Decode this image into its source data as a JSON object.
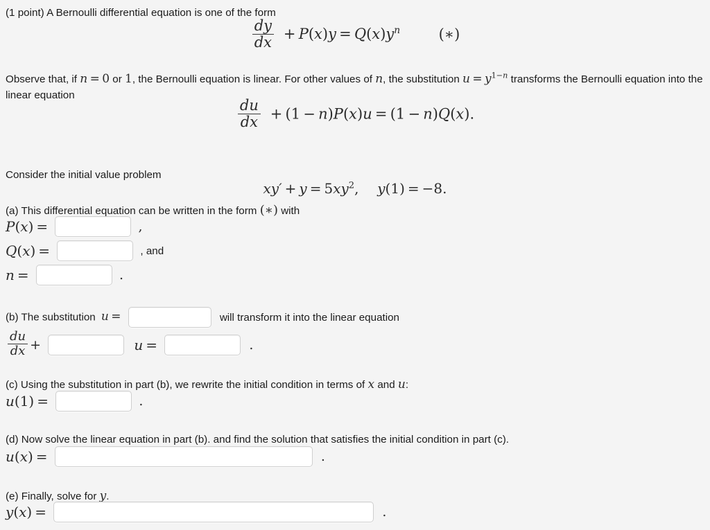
{
  "problem": {
    "points_label": "(1 point)",
    "intro_text": "A Bernoulli differential equation is one of the form",
    "star_tag": "(∗)",
    "observe_line1_a": "Observe that, if",
    "observe_n_eq_0": "n = 0",
    "observe_or": "or",
    "observe_one": "1",
    "observe_line1_b": ", the Bernoulli equation is linear. For other values of",
    "observe_n": "n",
    "observe_line1_c": ", the substitution",
    "observe_sub": "u = y^(1−n)",
    "observe_line1_d": "transforms the Bernoulli",
    "observe_line2": "equation into the linear equation",
    "consider_text": "Consider the initial value problem",
    "ivp": "xy′ + y = 5xy²,    y(1) = −8."
  },
  "equations": {
    "bernoulli": {
      "frac_numer": "dy",
      "frac_denom": "dx",
      "rest": "+ P(x)y = Q(x)yⁿ"
    },
    "linear": {
      "frac_numer": "du",
      "frac_denom": "dx",
      "rest": "+ (1 − n)P(x)u = (1 − n)Q(x)."
    }
  },
  "parts": {
    "a": {
      "prompt_pre": "(a) This differential equation can be written in the form",
      "prompt_star": "(∗)",
      "prompt_post": "with",
      "px_label": "P(x) =",
      "px_value": "",
      "px_trailing": ",",
      "qx_label": "Q(x) =",
      "qx_value": "",
      "qx_trailing": ", and",
      "n_label": "n =",
      "n_value": "",
      "n_trailing": "."
    },
    "b": {
      "prompt_pre": "(b) The substitution",
      "prompt_u": "u =",
      "u_value": "",
      "prompt_post": "will transform it into the linear equation",
      "frac_numer": "du",
      "frac_denom": "dx",
      "plus": "+",
      "coef_value": "",
      "u_eq": "u =",
      "rhs_value": "",
      "trailing": "."
    },
    "c": {
      "prompt_pre": "(c) Using the substitution in part (b), we rewrite the initial condition in terms of",
      "prompt_x": "x",
      "prompt_and": "and",
      "prompt_u": "u",
      "prompt_colon": ":",
      "u1_label": "u(1) =",
      "u1_value": "",
      "trailing": "."
    },
    "d": {
      "prompt": "(d) Now solve the linear equation in part (b). and find the solution that satisfies the initial condition in part (c).",
      "ux_label": "u(x) =",
      "ux_value": "",
      "trailing": "."
    },
    "e": {
      "prompt_pre": "(e) Finally, solve for",
      "prompt_y": "y",
      "prompt_period": ".",
      "yx_label": "y(x) =",
      "yx_value": "",
      "trailing": "."
    }
  },
  "style": {
    "background": "#f4f4f4",
    "text_color": "#1b1b1b",
    "math_color": "#2b2b2b",
    "input_border": "#cfcfcf",
    "input_background": "#ffffff"
  }
}
